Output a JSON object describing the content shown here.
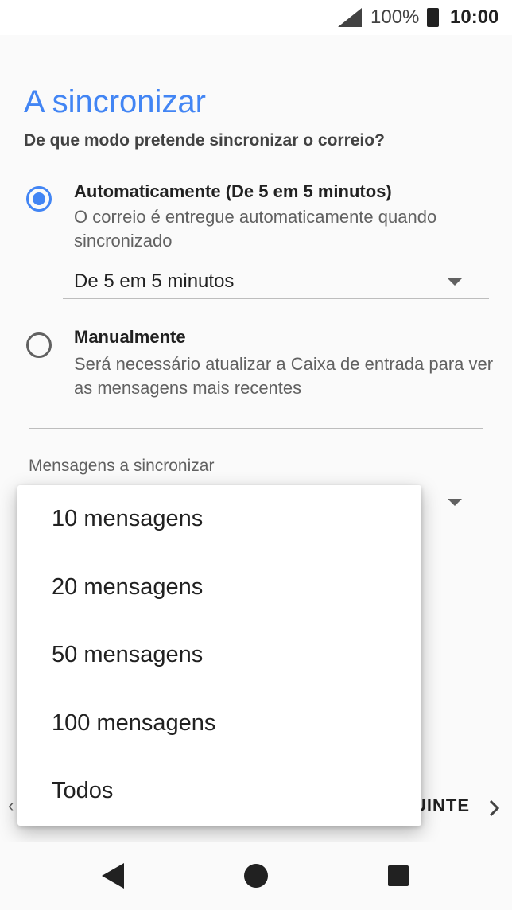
{
  "status_bar": {
    "battery_percent": "100%",
    "time": "10:00"
  },
  "page": {
    "title": "A sincronizar",
    "subtitle": "De que modo pretende sincronizar o correio?"
  },
  "sync_options": [
    {
      "title": "Automaticamente (De 5 em 5 minutos)",
      "description": "O correio é entregue automaticamente quando sincronizado",
      "selected": true
    },
    {
      "title": "Manualmente",
      "description": "Será necessário atualizar a Caixa de entrada para ver as mensagens mais recentes",
      "selected": false
    }
  ],
  "frequency_spinner": {
    "value": "De 5 em 5 minutos"
  },
  "messages_section": {
    "label": "Mensagens a sincronizar"
  },
  "footer": {
    "next_label": "UINTE"
  },
  "dropdown": {
    "items": [
      "10 mensagens",
      "20 mensagens",
      "50 mensagens",
      "100 mensagens",
      "Todos"
    ]
  },
  "colors": {
    "accent": "#4285f4",
    "text_primary": "#212121",
    "text_secondary": "#616161"
  }
}
